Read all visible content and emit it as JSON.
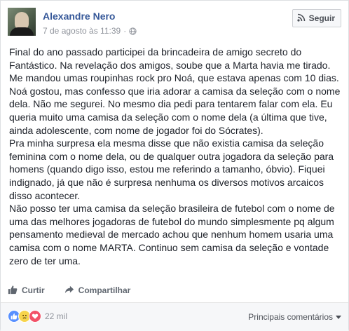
{
  "post": {
    "author": "Alexandre Nero",
    "date": "7 de agosto às 11:39",
    "separator": "·",
    "follow_label": "Seguir",
    "paragraphs": [
      "Final do ano passado participei da brincadeira de amigo secreto do Fantástico. Na revelação dos amigos, soube que a Marta havia me tirado. Me mandou umas roupinhas rock pro Noá, que estava apenas com 10 dias. Noá gostou, mas confesso que iria adorar a camisa da seleção com o nome dela. Não me segurei. No mesmo dia pedi para tentarem falar com ela. Eu queria muito uma camisa da seleção com o nome dela (a última que tive, ainda adolescente, com nome de jogador foi do Sócrates).",
      "Pra minha surpresa ela mesma disse que não existia camisa da seleção feminina com o nome dela, ou de qualquer outra jogadora da seleção para homens (quando digo isso, estou me referindo a tamanho, óbvio). Fiquei indignado, já que não é surpresa nenhuma os diversos motivos arcaicos disso acontecer.",
      "Não posso ter uma camisa da seleção brasileira de futebol com o nome de uma das melhores jogadoras de futebol do mundo simplesmente pq algum pensamento medieval de mercado achou que nenhum homem usaria uma camisa com o nome MARTA. Continuo sem camisa da seleção e vontade zero de ter uma."
    ]
  },
  "actions": {
    "like_label": "Curtir",
    "share_label": "Compartilhar"
  },
  "footer": {
    "reaction_count": "22 mil",
    "sort_label": "Principais comentários"
  },
  "icons": {
    "globe": "globe-icon",
    "follow": "rss-icon",
    "like": "thumbs-up-icon",
    "share": "share-arrow-icon",
    "reactions": [
      "like-reaction-icon",
      "sad-reaction-icon",
      "love-reaction-icon"
    ],
    "sort": "caret-down-icon"
  },
  "colors": {
    "link": "#365899",
    "muted": "#90949c",
    "text": "#1d2129",
    "like_blue": "#5890ff",
    "love_red": "#f25268",
    "sad_yellow": "#f7d44c"
  }
}
